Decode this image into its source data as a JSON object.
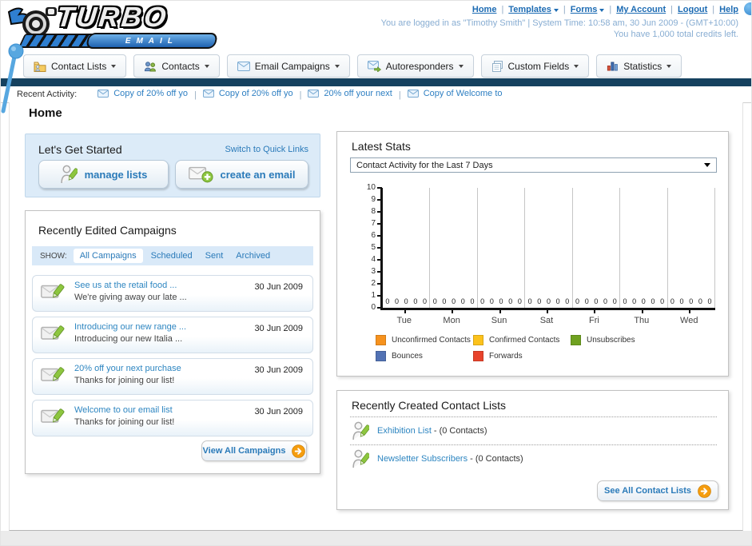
{
  "header": {
    "logo": {
      "brand": "TURBO",
      "sub": "EMAIL"
    },
    "nav_links": [
      {
        "label": "Home",
        "caret": false
      },
      {
        "label": "Templates",
        "caret": true
      },
      {
        "label": "Forms",
        "caret": true
      },
      {
        "label": "My Account",
        "caret": false
      },
      {
        "label": "Logout",
        "caret": false
      },
      {
        "label": "Help",
        "caret": false
      }
    ],
    "login_info": "You are logged in as \"Timothy Smith\" | System Time: 10:58 am, 30 Jun 2009 - (GMT+10:00)",
    "credits_info": "You have 1,000 total credits left."
  },
  "nav_tabs": [
    {
      "label": "Contact Lists",
      "icon": "folder-icon"
    },
    {
      "label": "Contacts",
      "icon": "contacts-icon"
    },
    {
      "label": "Email Campaigns",
      "icon": "envelope-icon"
    },
    {
      "label": "Autoresponders",
      "icon": "autoresponder-icon"
    },
    {
      "label": "Custom Fields",
      "icon": "custom-fields-icon"
    },
    {
      "label": "Statistics",
      "icon": "statistics-icon"
    }
  ],
  "recent_activity": {
    "label": "Recent Activity:",
    "items": [
      "Copy of 20% off yo",
      "Copy of 20% off yo",
      "20% off your next",
      "Copy of Welcome to"
    ]
  },
  "page_title": "Home",
  "get_started": {
    "title": "Let's Get Started",
    "switch_link": "Switch to Quick Links",
    "buttons": [
      {
        "label": "manage lists",
        "icon": "person-pencil-icon"
      },
      {
        "label": "create an email",
        "icon": "envelope-plus-icon"
      }
    ]
  },
  "campaigns": {
    "title": "Recently Edited Campaigns",
    "show_label": "SHOW:",
    "filters": [
      {
        "label": "All Campaigns",
        "active": true
      },
      {
        "label": "Scheduled",
        "active": false
      },
      {
        "label": "Sent",
        "active": false
      },
      {
        "label": "Archived",
        "active": false
      }
    ],
    "items": [
      {
        "title": "See us at the retail food ...",
        "subtitle": "We're giving away our late ...",
        "date": "30 Jun 2009"
      },
      {
        "title": "Introducing our new range ...",
        "subtitle": "Introducing our new Italia ...",
        "date": "30 Jun 2009"
      },
      {
        "title": "20% off your next purchase",
        "subtitle": "Thanks for joining our list!",
        "date": "30 Jun 2009"
      },
      {
        "title": "Welcome to our email list",
        "subtitle": "Thanks for joining our list!",
        "date": "30 Jun 2009"
      }
    ],
    "view_all_label": "View All Campaigns"
  },
  "stats": {
    "title": "Latest Stats",
    "period_selected": "Contact Activity for the Last 7 Days"
  },
  "chart_data": {
    "type": "bar",
    "title": "Contact Activity for the Last 7 Days",
    "categories": [
      "Tue",
      "Mon",
      "Sun",
      "Sat",
      "Fri",
      "Thu",
      "Wed"
    ],
    "series": [
      {
        "name": "Unconfirmed Contacts",
        "color": "#f6921e",
        "values": [
          0,
          0,
          0,
          0,
          0,
          0,
          0
        ]
      },
      {
        "name": "Confirmed Contacts",
        "color": "#fcc21c",
        "values": [
          0,
          0,
          0,
          0,
          0,
          0,
          0
        ]
      },
      {
        "name": "Unsubscribes",
        "color": "#6fa120",
        "values": [
          0,
          0,
          0,
          0,
          0,
          0,
          0
        ]
      },
      {
        "name": "Bounces",
        "color": "#5272b4",
        "values": [
          0,
          0,
          0,
          0,
          0,
          0,
          0
        ]
      },
      {
        "name": "Forwards",
        "color": "#e8432c",
        "values": [
          0,
          0,
          0,
          0,
          0,
          0,
          0
        ]
      }
    ],
    "xlabel": "",
    "ylabel": "",
    "ylim": [
      0,
      10
    ],
    "yticks": [
      0,
      1,
      2,
      3,
      4,
      5,
      6,
      7,
      8,
      9,
      10
    ],
    "grid": "vertical",
    "legend_position": "bottom",
    "value_labels_shown": true
  },
  "contact_lists": {
    "title": "Recently Created Contact Lists",
    "items": [
      {
        "name": "Exhibition List",
        "detail": "- (0 Contacts)"
      },
      {
        "name": "Newsletter Subscribers",
        "detail": "- (0 Contacts)"
      }
    ],
    "see_all_label": "See All Contact Lists"
  },
  "colors": {
    "accent_blue": "#2a7ab9",
    "navy_bar": "#15415f",
    "panel_blue_bg": "#dcebf8",
    "show_bar_bg": "#d9e9f8",
    "arrow_orange": "#f59d0f",
    "pencil_green": "#8dc63f"
  }
}
